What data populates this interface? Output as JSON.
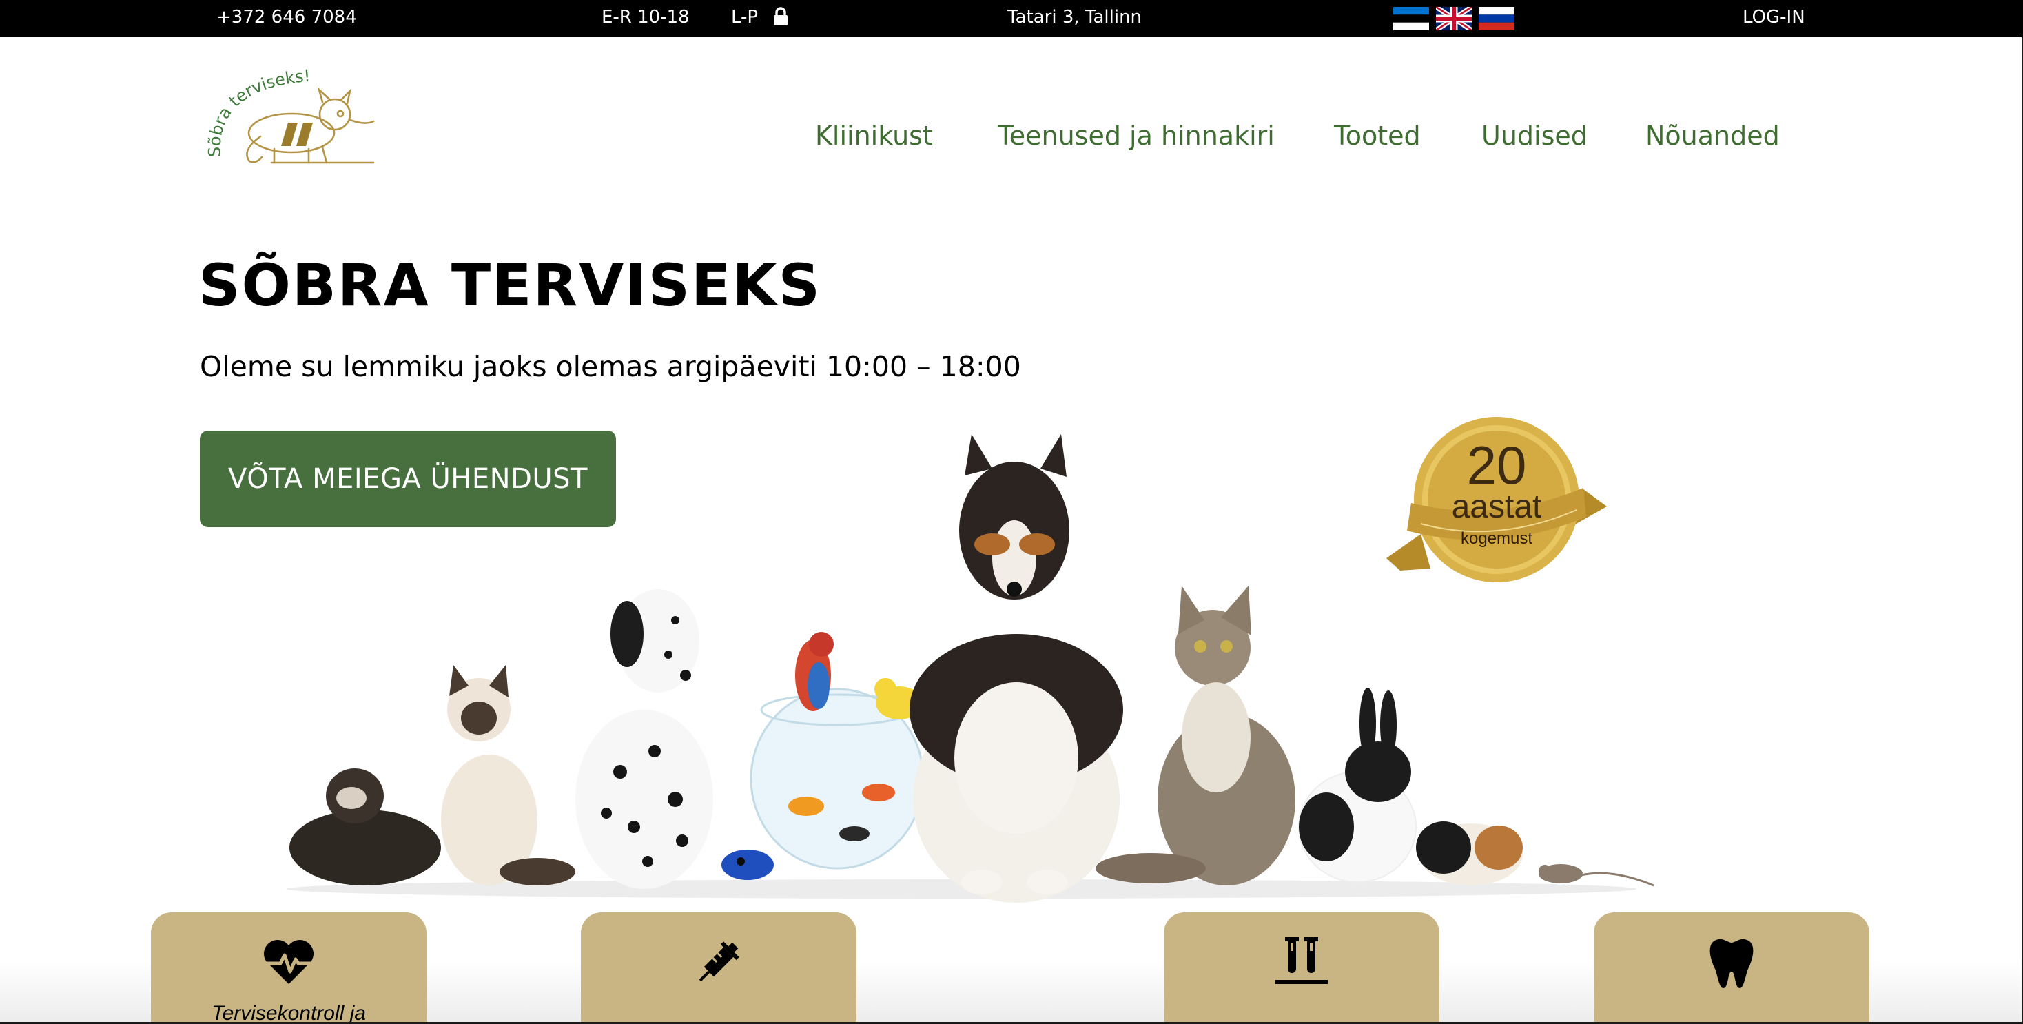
{
  "topbar": {
    "phone": "+372 646 7084",
    "hours_weekdays": "E-R 10-18",
    "hours_weekend": "L-P",
    "weekend_icon": "lock-icon",
    "address": "Tatari 3, Tallinn",
    "languages": [
      "Estonian flag",
      "British flag",
      "Russian flag"
    ],
    "login": "LOG-IN"
  },
  "logo": {
    "text": "Sõbra terviseks!"
  },
  "nav": {
    "items": [
      "Kliinikust",
      "Teenused ja hinnakiri",
      "Tooted",
      "Uudised",
      "Nõuanded"
    ]
  },
  "hero": {
    "title": "SÕBRA TERVISEKS",
    "subtitle": "Oleme su lemmiku jaoks olemas argipäeviti 10:00 – 18:00",
    "cta_label": "VÕTA MEIEGA ÜHENDUST",
    "badge": {
      "number": "20",
      "word": "aastat",
      "ribbon": "kogemust"
    }
  },
  "services": [
    {
      "icon": "heartbeat-icon",
      "label": "Tervisekontroll ja"
    },
    {
      "icon": "syringe-icon",
      "label": ""
    },
    {
      "icon": "test-tubes-icon",
      "label": ""
    },
    {
      "icon": "tooth-icon",
      "label": ""
    }
  ],
  "colors": {
    "topbar_bg": "#000000",
    "nav_text": "#3e6c31",
    "cta_bg": "#48703f",
    "card_bg": "#c8b583",
    "badge_gold": "#d9b24a"
  }
}
